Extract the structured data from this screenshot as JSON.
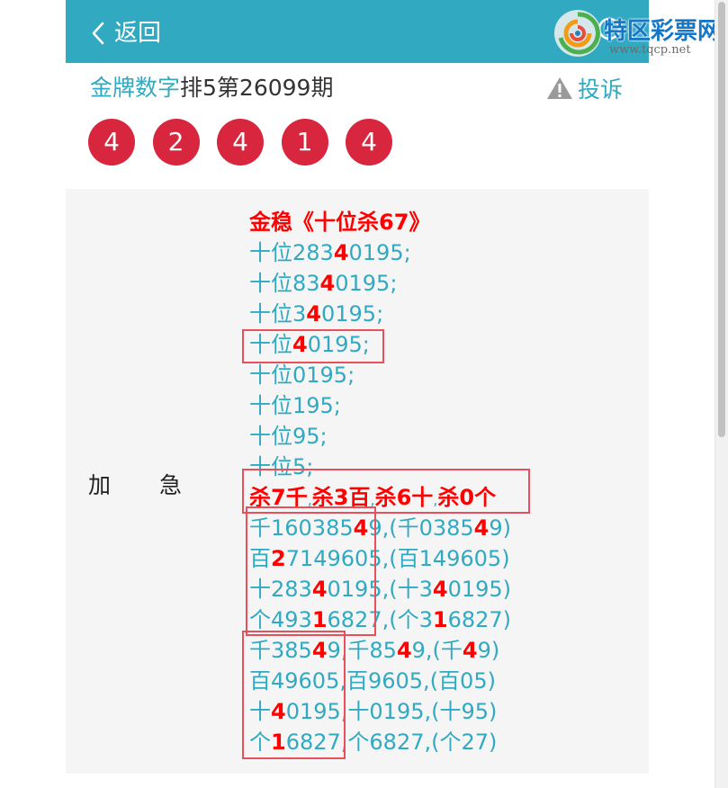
{
  "header": {
    "back_label": "返回",
    "logo_name": "特区彩票网",
    "logo_url": "www.tqcp.net"
  },
  "title": {
    "link": "金牌数字",
    "text": "排5第26099期"
  },
  "complain_label": "投诉",
  "balls": [
    "4",
    "2",
    "4",
    "1",
    "4"
  ],
  "urgent": {
    "char1": "加",
    "char2": "急"
  },
  "tips": [
    {
      "kind": "head",
      "parts": [
        {
          "t": "金稳《十位杀67》",
          "hl": false
        }
      ]
    },
    {
      "kind": "normal",
      "parts": [
        {
          "t": "十位283",
          "hl": false
        },
        {
          "t": "4",
          "hl": true
        },
        {
          "t": "0195;",
          "hl": false
        }
      ]
    },
    {
      "kind": "normal",
      "parts": [
        {
          "t": "十位83",
          "hl": false
        },
        {
          "t": "4",
          "hl": true
        },
        {
          "t": "0195;",
          "hl": false
        }
      ]
    },
    {
      "kind": "normal",
      "parts": [
        {
          "t": "十位3",
          "hl": false
        },
        {
          "t": "4",
          "hl": true
        },
        {
          "t": "0195;",
          "hl": false
        }
      ]
    },
    {
      "kind": "normal",
      "parts": [
        {
          "t": "十位",
          "hl": false
        },
        {
          "t": "4",
          "hl": true
        },
        {
          "t": "0195;",
          "hl": false
        }
      ]
    },
    {
      "kind": "normal",
      "parts": [
        {
          "t": "十位0195;",
          "hl": false
        }
      ]
    },
    {
      "kind": "normal",
      "parts": [
        {
          "t": "十位195;",
          "hl": false
        }
      ]
    },
    {
      "kind": "normal",
      "parts": [
        {
          "t": "十位95;",
          "hl": false
        }
      ]
    },
    {
      "kind": "normal",
      "parts": [
        {
          "t": "十位5;",
          "hl": false
        }
      ]
    },
    {
      "kind": "kill",
      "parts": [
        {
          "t": "杀7千",
          "hl": true
        },
        {
          "t": ",",
          "hl": false,
          "sep": true
        },
        {
          "t": "杀3百",
          "hl": true
        },
        {
          "t": ",",
          "hl": false,
          "sep": true
        },
        {
          "t": "杀6十",
          "hl": true
        },
        {
          "t": ",",
          "hl": false,
          "sep": true
        },
        {
          "t": "杀0个",
          "hl": true
        }
      ]
    },
    {
      "kind": "normal",
      "parts": [
        {
          "t": "千160385",
          "hl": false
        },
        {
          "t": "4",
          "hl": true
        },
        {
          "t": "9,(千0385",
          "hl": false
        },
        {
          "t": "4",
          "hl": true
        },
        {
          "t": "9)",
          "hl": false
        }
      ]
    },
    {
      "kind": "normal",
      "parts": [
        {
          "t": "百",
          "hl": false
        },
        {
          "t": "2",
          "hl": true
        },
        {
          "t": "7149605,(百149605)",
          "hl": false
        }
      ]
    },
    {
      "kind": "normal",
      "parts": [
        {
          "t": "十283",
          "hl": false
        },
        {
          "t": "4",
          "hl": true
        },
        {
          "t": "0195,(十3",
          "hl": false
        },
        {
          "t": "4",
          "hl": true
        },
        {
          "t": "0195)",
          "hl": false
        }
      ]
    },
    {
      "kind": "normal",
      "parts": [
        {
          "t": "个493",
          "hl": false
        },
        {
          "t": "1",
          "hl": true
        },
        {
          "t": "6827,(个3",
          "hl": false
        },
        {
          "t": "1",
          "hl": true
        },
        {
          "t": "6827)",
          "hl": false
        }
      ]
    },
    {
      "kind": "normal",
      "parts": [
        {
          "t": "千385",
          "hl": false
        },
        {
          "t": "4",
          "hl": true
        },
        {
          "t": "9,千85",
          "hl": false
        },
        {
          "t": "4",
          "hl": true
        },
        {
          "t": "9,(千",
          "hl": false
        },
        {
          "t": "4",
          "hl": true
        },
        {
          "t": "9)",
          "hl": false
        }
      ]
    },
    {
      "kind": "normal",
      "parts": [
        {
          "t": "百49605,百9605,(百05)",
          "hl": false
        }
      ]
    },
    {
      "kind": "normal",
      "parts": [
        {
          "t": "十",
          "hl": false
        },
        {
          "t": "4",
          "hl": true
        },
        {
          "t": "0195,十0195,(十95)",
          "hl": false
        }
      ]
    },
    {
      "kind": "normal",
      "parts": [
        {
          "t": "个",
          "hl": false
        },
        {
          "t": "1",
          "hl": true
        },
        {
          "t": "6827,个6827,(个27)",
          "hl": false
        }
      ]
    }
  ],
  "colors": {
    "header_bg": "#31a9c1",
    "accent_text": "#31a9c1",
    "ball_red": "#d7263d",
    "highlight_red": "#ff0000",
    "box_red": "#e8505b",
    "content_bg": "#f5f5f5"
  }
}
